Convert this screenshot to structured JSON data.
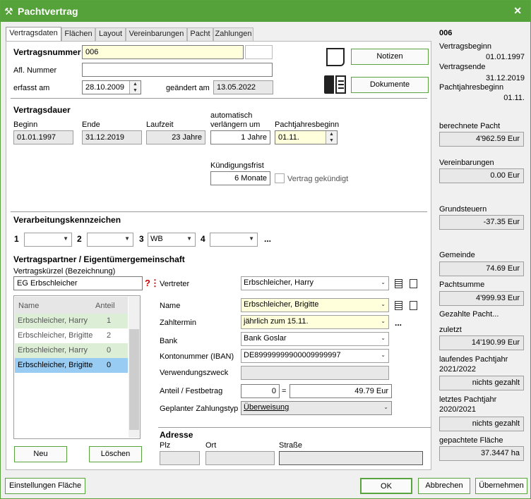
{
  "window": {
    "title": "Pachtvertrag",
    "close": "✕"
  },
  "tabs": [
    "Vertragsdaten",
    "Flächen",
    "Layout",
    "Vereinbarungen",
    "Pacht",
    "Zahlungen"
  ],
  "header": {
    "vertragsnummer_label": "Vertragsnummer",
    "vertragsnummer": "006",
    "afl_nummer_label": "Afl. Nummer",
    "afl_nummer": "",
    "erfasst_label": "erfasst am",
    "erfasst": "28.10.2009",
    "geaendert_label": "geändert am",
    "geaendert": "13.05.2022",
    "notizen": "Notizen",
    "dokumente": "Dokumente"
  },
  "dauer": {
    "section": "Vertragsdauer",
    "beginn_label": "Beginn",
    "beginn": "01.01.1997",
    "ende_label": "Ende",
    "ende": "31.12.2019",
    "laufzeit_label": "Laufzeit",
    "laufzeit": "23 Jahre",
    "auto_label1": "automatisch",
    "auto_label2": "verlängern um",
    "auto": "1 Jahre",
    "pachtjahr_label": "Pachtjahresbeginn",
    "pachtjahr": "01.11.",
    "kuendigung_label": "Kündigungsfrist",
    "kuendigung": "6 Monate",
    "gekuendigt_label": "Vertrag gekündigt"
  },
  "kennzeichen": {
    "section": "Verarbeitungskennzeichen",
    "n1": "1",
    "n2": "2",
    "n3": "3",
    "n4": "4",
    "v1": "",
    "v2": "",
    "v3": "WB",
    "v4": "",
    "more": "..."
  },
  "partner": {
    "section": "Vertragspartner / Eigentümergemeinschaft",
    "kuerzel_label": "Vertragskürzel (Bezeichnung)",
    "kuerzel": "EG Erbschleicher",
    "col_name": "Name",
    "col_anteil": "Anteil",
    "rows": [
      {
        "name": "Erbschleicher, Harry",
        "anteil": "1"
      },
      {
        "name": "Erbschleicher, Brigitte",
        "anteil": "2"
      },
      {
        "name": "Erbschleicher, Harry",
        "anteil": "0"
      },
      {
        "name": "Erbschleicher, Brigitte",
        "anteil": "0"
      }
    ],
    "neu": "Neu",
    "loeschen": "Löschen",
    "vertreter_label": "Vertreter",
    "vertreter": "Erbschleicher, Harry",
    "name_label": "Name",
    "name": "Erbschleicher, Brigitte",
    "zahltermin_label": "Zahltermin",
    "zahltermin": "jährlich zum 15.11.",
    "bank_label": "Bank",
    "bank": "Bank Goslar",
    "iban_label": "Kontonummer (IBAN)",
    "iban": "DE89999999900009999997",
    "zweck_label": "Verwendungszweck",
    "zweck": "",
    "anteil_label": "Anteil / Festbetrag",
    "anteil": "0",
    "eq": "=",
    "betrag": "49.79 Eur",
    "typ_label": "Geplanter Zahlungstyp",
    "typ": "Überweisung",
    "more": "...",
    "adresse": "Adresse",
    "plz": "Plz",
    "ort": "Ort",
    "strasse": "Straße"
  },
  "side": {
    "id": "006",
    "vb_label": "Vertragsbeginn",
    "vb": "01.01.1997",
    "ve_label": "Vertragsende",
    "ve": "31.12.2019",
    "pjb_label": "Pachtjahresbeginn",
    "pjb": "01.11.",
    "ber_label": "berechnete Pacht",
    "ber": "4'962.59 Eur",
    "ver_label": "Vereinbarungen",
    "ver": "0.00 Eur",
    "gs_label": "Grundsteuern",
    "gs": "-37.35 Eur",
    "gem_label": "Gemeinde",
    "gem": "74.69 Eur",
    "ps_label": "Pachtsumme",
    "ps": "4'999.93 Eur",
    "gez_label": "Gezahlte Pacht...",
    "zul_label": "zuletzt",
    "zul": "14'190.99 Eur",
    "lfd_label1": "laufendes Pachtjahr",
    "lfd_label2": "2021/2022",
    "lfd": "nichts gezahlt",
    "lz_label1": "letztes Pachtjahr",
    "lz_label2": "2020/2021",
    "lz": "nichts gezahlt",
    "fl_label": "gepachtete Fläche",
    "fl": "37.3447 ha"
  },
  "footer": {
    "einstellungen": "Einstellungen Fläche",
    "ok": "OK",
    "abbrechen": "Abbrechen",
    "uebernehmen": "Übernehmen"
  },
  "colors": {
    "brand": "#55a13a",
    "selected_row": "#99ccf3",
    "alt_row": "#dcefd6",
    "yellow_field": "#ffffdc"
  }
}
